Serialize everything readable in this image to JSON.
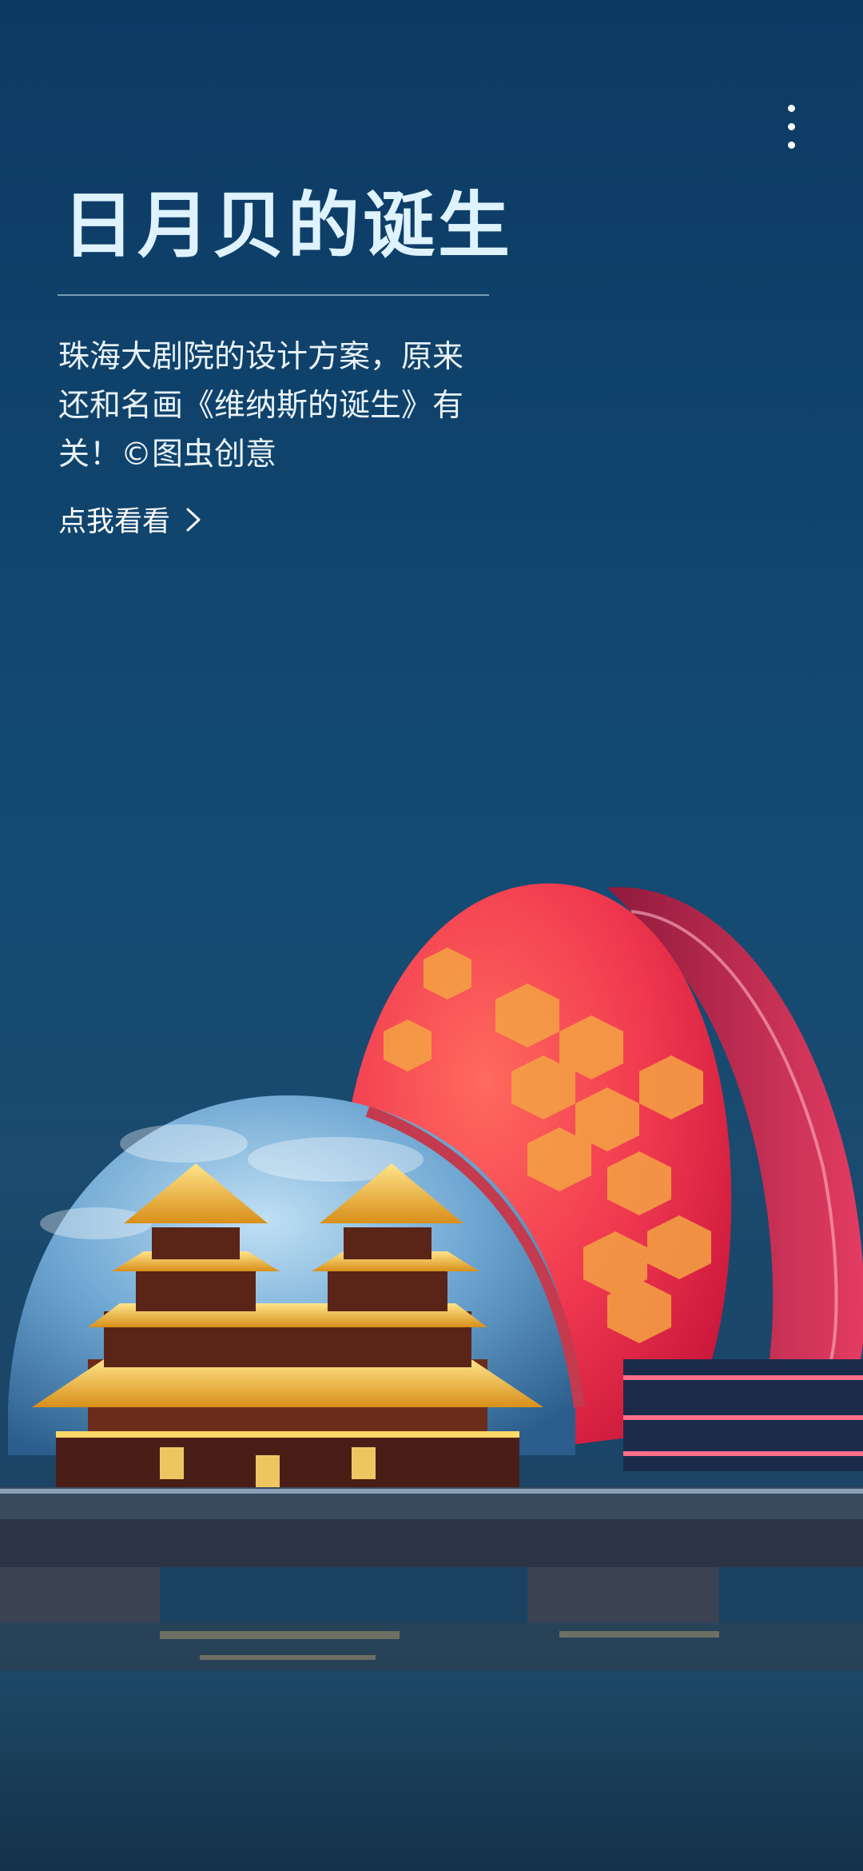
{
  "story": {
    "title": "日月贝的诞生",
    "description": "珠海大剧院的设计方案，原来还和名画《维纳斯的诞生》有关！©图虫创意",
    "cta_label": "点我看看"
  },
  "icons": {
    "more": "more-vertical-icon",
    "cta_arrow": "chevron-right-icon"
  },
  "colors": {
    "sky_top": "#0c3a63",
    "sky_bottom": "#174a70",
    "shell_large": "#f0384f",
    "shell_pattern": "#f4a344",
    "shell_small": "#7fb0d8",
    "title_text": "#dff3ff"
  }
}
